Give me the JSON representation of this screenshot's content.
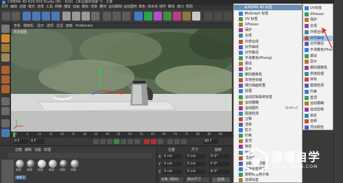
{
  "window": {
    "title": "CINEMA 4D R20.059 Studio (RC - R20) - [未设置的场景 *] - 主要",
    "controls": [
      "–",
      "□",
      "✕"
    ]
  },
  "menubar": [
    "文件",
    "编辑",
    "创建",
    "模式",
    "选择",
    "工具",
    "网格",
    "捕捉",
    "动画",
    "模拟",
    "渲染",
    "雕刻",
    "运动跟踪",
    "运动图形",
    "角色",
    "流水线",
    "插件",
    "脚本",
    "窗口",
    "帮助"
  ],
  "viewport": {
    "menu": [
      "查看",
      "摄像机",
      "显示",
      "选项",
      "过滤",
      "面板",
      "ProRender"
    ],
    "label": "透视视图"
  },
  "timeline": {
    "ticks": [
      "0",
      "5",
      "10",
      "15",
      "20",
      "25",
      "30",
      "35",
      "40",
      "45",
      "50",
      "55",
      "60",
      "65",
      "70",
      "75",
      "80",
      "85",
      "90"
    ],
    "start_field": "0 F",
    "end_field": "90 F",
    "current_frame": "0 F"
  },
  "material_panel": {
    "tabs": [
      "创建",
      "编辑",
      "功能",
      "纹理"
    ],
    "materials": [
      {
        "name": "材质",
        "color": "#8a8a8a"
      },
      {
        "name": "材质",
        "color": "#5b5b5b"
      },
      {
        "name": "材质",
        "color": "#b8b8b8"
      },
      {
        "name": "材质",
        "color": "#9a9a9a"
      },
      {
        "name": "材质",
        "color": "#4b4b4b"
      },
      {
        "name": "材质",
        "color": "#7b7b7b"
      }
    ],
    "selected_material": "材质.2"
  },
  "coord_panel": {
    "headers": [
      "位置",
      "尺寸",
      "旋转"
    ],
    "rows": [
      {
        "axis": "X",
        "pos": "0 cm",
        "size": "0 cm",
        "rot": "H 0°"
      },
      {
        "axis": "Y",
        "pos": "0 cm",
        "size": "0 cm",
        "rot": "P 0°"
      },
      {
        "axis": "Z",
        "pos": "0 cm",
        "size": "0 cm",
        "rot": "B 0°"
      }
    ],
    "mode": "对象 (相对)",
    "size_mode": "绝对尺寸",
    "apply": "应用"
  },
  "menu_main": {
    "header": "CINEMA 4D 标签",
    "items": [
      {
        "label": "MoGraph 标签",
        "arrow": "▸",
        "shortcut": ""
      },
      {
        "label": "UV 标签",
        "arrow": "",
        "shortcut": ""
      },
      {
        "label": "XPresso",
        "arrow": "",
        "shortcut": ""
      },
      {
        "label": "保护",
        "arrow": "",
        "shortcut": ""
      },
      {
        "label": "合成",
        "arrow": "",
        "shortcut": ""
      },
      {
        "label": "外部合成",
        "arrow": "",
        "shortcut": ""
      },
      {
        "label": "对齐曲线",
        "arrow": "",
        "shortcut": ""
      },
      {
        "label": "对齐路径",
        "arrow": "",
        "shortcut": ""
      },
      {
        "label": "平滑着色(Phong)",
        "arrow": "",
        "shortcut": ""
      },
      {
        "label": "振动",
        "arrow": "",
        "shortcut": ""
      },
      {
        "label": "显示",
        "arrow": "",
        "shortcut": ""
      },
      {
        "label": "朝向摄像机",
        "arrow": "",
        "shortcut": ""
      },
      {
        "label": "本地坐标轴",
        "arrow": "",
        "shortcut": ""
      },
      {
        "label": "细分曲面权重",
        "arrow": "",
        "shortcut": ""
      },
      {
        "label": "纹理",
        "arrow": "",
        "shortcut": ""
      },
      {
        "label": "运动剪辑系统标签",
        "arrow": "",
        "shortcut": ""
      },
      {
        "label": "运动模糊",
        "arrow": "",
        "shortcut": ""
      },
      {
        "label": "运动图形",
        "arrow": "",
        "shortcut": "Shift+C"
      },
      {
        "label": "碰撞检测",
        "arrow": "",
        "shortcut": ""
      },
      {
        "label": "注释",
        "arrow": "",
        "shortcut": ""
      },
      {
        "label": "渲染",
        "arrow": "",
        "shortcut": ""
      },
      {
        "label": "粒子",
        "arrow": "",
        "shortcut": ""
      },
      {
        "label": "约束",
        "arrow": "",
        "shortcut": ""
      },
      {
        "label": "置顶",
        "arrow": "",
        "shortcut": ""
      },
      {
        "label": "锁定",
        "arrow": "",
        "shortcut": ""
      },
      {
        "label": "音频",
        "arrow": "",
        "shortcut": ""
      },
      {
        "label": "顶点颜色",
        "arrow": "",
        "shortcut": ""
      },
      {
        "label": "加载标签预置",
        "arrow": "▸",
        "shortcut": ""
      },
      {
        "label": "保存标签预置",
        "arrow": "",
        "shortcut": ""
      },
      {
        "label": "复制标签到子级",
        "arrow": "",
        "shortcut": ""
      },
      {
        "label": "选择标签",
        "arrow": "",
        "shortcut": ""
      }
    ]
  },
  "menu_sub": {
    "items": [
      "UV标签",
      "XPresso",
      "保护",
      "合成",
      "外部合成",
      "对齐曲线",
      "对齐路径",
      "平滑着色(Phong)",
      "振动",
      "显示",
      "朝向摄像机",
      "烘焙纹理",
      "目标",
      "碰撞检测",
      "约束",
      "置顶",
      "运动模糊",
      "运动剪辑",
      "锁定",
      "音频",
      "顶点颜色"
    ],
    "highlight_index": 5
  },
  "watermark": {
    "brand": "溜溜自学",
    "url": "ZIXUE.3D66.COM"
  },
  "colors": {
    "menu_highlight": "#9cc6ea",
    "x_axis": "#e0342b",
    "y_axis": "#3cc43c",
    "z_axis": "#3a60e8",
    "annotation_arrow": "#e0342b"
  }
}
